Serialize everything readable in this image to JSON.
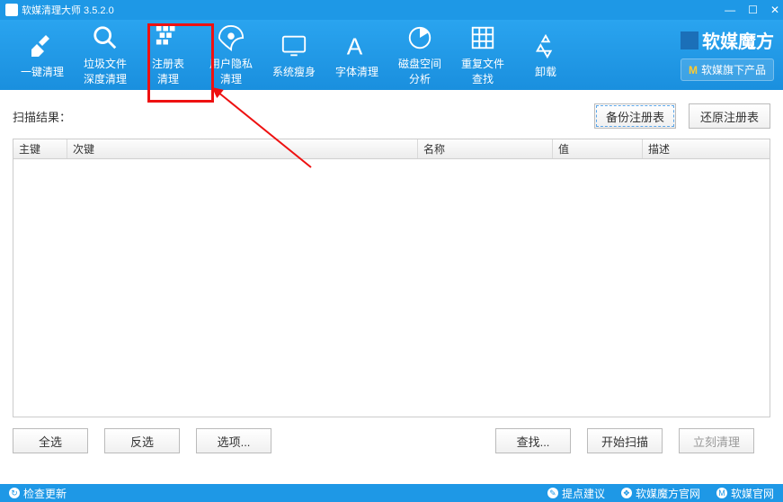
{
  "title": "软媒清理大师 3.5.2.0",
  "toolbar": [
    {
      "label": "一键清理"
    },
    {
      "label": "垃圾文件\n深度清理"
    },
    {
      "label": "注册表\n清理"
    },
    {
      "label": "用户隐私\n清理"
    },
    {
      "label": "系统瘦身"
    },
    {
      "label": "字体清理"
    },
    {
      "label": "磁盘空间\n分析"
    },
    {
      "label": "重复文件\n查找"
    },
    {
      "label": "卸载"
    }
  ],
  "brand": {
    "name": "软媒魔方",
    "sub_btn": "软媒旗下产品"
  },
  "body": {
    "result_label": "扫描结果：",
    "backup_btn": "备份注册表",
    "restore_btn": "还原注册表",
    "columns": {
      "c1": "主键",
      "c2": "次键",
      "c3": "名称",
      "c4": "值",
      "c5": "描述"
    },
    "bottom": {
      "select_all": "全选",
      "invert": "反选",
      "options": "选项...",
      "find": "查找...",
      "start": "开始扫描",
      "clean": "立刻清理"
    }
  },
  "status": {
    "check_update": "检查更新",
    "suggest": "提点建议",
    "site1": "软媒魔方官网",
    "site2": "软媒官网"
  }
}
